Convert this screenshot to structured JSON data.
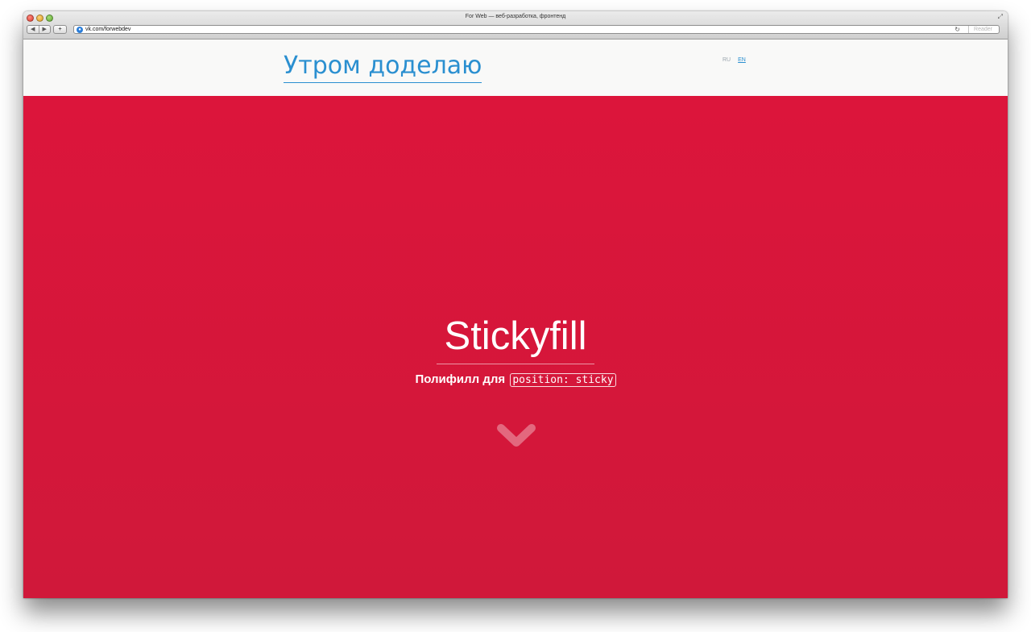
{
  "browser": {
    "window_title": "For Web — веб-разработка, фронтенд",
    "back_label": "◀",
    "forward_label": "▶",
    "add_label": "+",
    "url": "vk.com/forwebdev",
    "reload_icon": "reload-icon",
    "reader_label": "Reader"
  },
  "header": {
    "site_title": "Утром доделаю",
    "lang_ru": "RU",
    "lang_en": "EN"
  },
  "hero": {
    "title": "Stickyfill",
    "subtitle_text": "Полифилл для",
    "subtitle_code": "position: sticky",
    "scroll_icon": "chevron-down-icon",
    "bg_color": "#dc153b"
  }
}
